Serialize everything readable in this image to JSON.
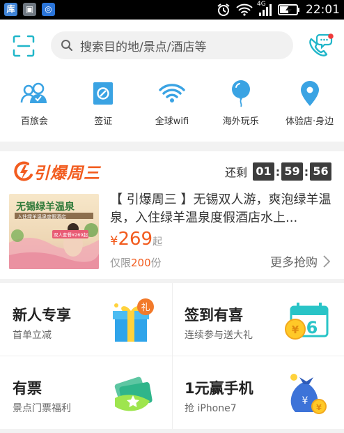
{
  "status_bar": {
    "apps": [
      {
        "name": "app-ku",
        "glyph": "库",
        "color": "#3f83d6"
      },
      {
        "name": "app-gallery",
        "glyph": "▣",
        "color": "#6e7781"
      },
      {
        "name": "app-blue",
        "glyph": "◎",
        "color": "#2a74d8"
      }
    ],
    "network": "4G",
    "time": "22:01"
  },
  "search": {
    "placeholder": "搜索目的地/景点/酒店等"
  },
  "quick_nav": [
    {
      "label": "百旅会",
      "icon": "group-icon"
    },
    {
      "label": "签证",
      "icon": "visa-icon"
    },
    {
      "label": "全球wifi",
      "icon": "wifi-icon"
    },
    {
      "label": "海外玩乐",
      "icon": "balloon-icon"
    },
    {
      "label": "体验店·身边",
      "icon": "location-pin-icon"
    }
  ],
  "flash_sale": {
    "logo": "引爆周三",
    "countdown_label": "还剩",
    "countdown": [
      "01",
      "59",
      "56"
    ],
    "thumb_text": "无锡绿羊温泉",
    "thumb_banner": "入住绿羊温泉度假酒店",
    "thumb_badge": "双人套餐¥269起",
    "title": "【 引爆周三 】无锡双人游，爽泡绿羊温泉，入住绿羊温泉度假酒店水上...",
    "price_currency": "¥",
    "price": "269",
    "price_suffix": "起",
    "limit_prefix": "仅限",
    "limit_count": "200",
    "limit_suffix": "份",
    "more_label": "更多抢购"
  },
  "grid": [
    {
      "title": "新人专享",
      "subtitle": "首单立减",
      "icon": "gift-box-icon"
    },
    {
      "title": "签到有喜",
      "subtitle": "连续参与送大礼",
      "icon": "checkin-calendar-icon"
    },
    {
      "title": "有票",
      "subtitle": "景点门票福利",
      "icon": "tickets-icon"
    },
    {
      "title": "1元赢手机",
      "subtitle": "抢 iPhone7",
      "icon": "money-bag-icon"
    }
  ],
  "colors": {
    "accent": "#20b6c9",
    "promo_orange": "#f25c1f",
    "nav_icon_blue": "#3aa3e3"
  }
}
